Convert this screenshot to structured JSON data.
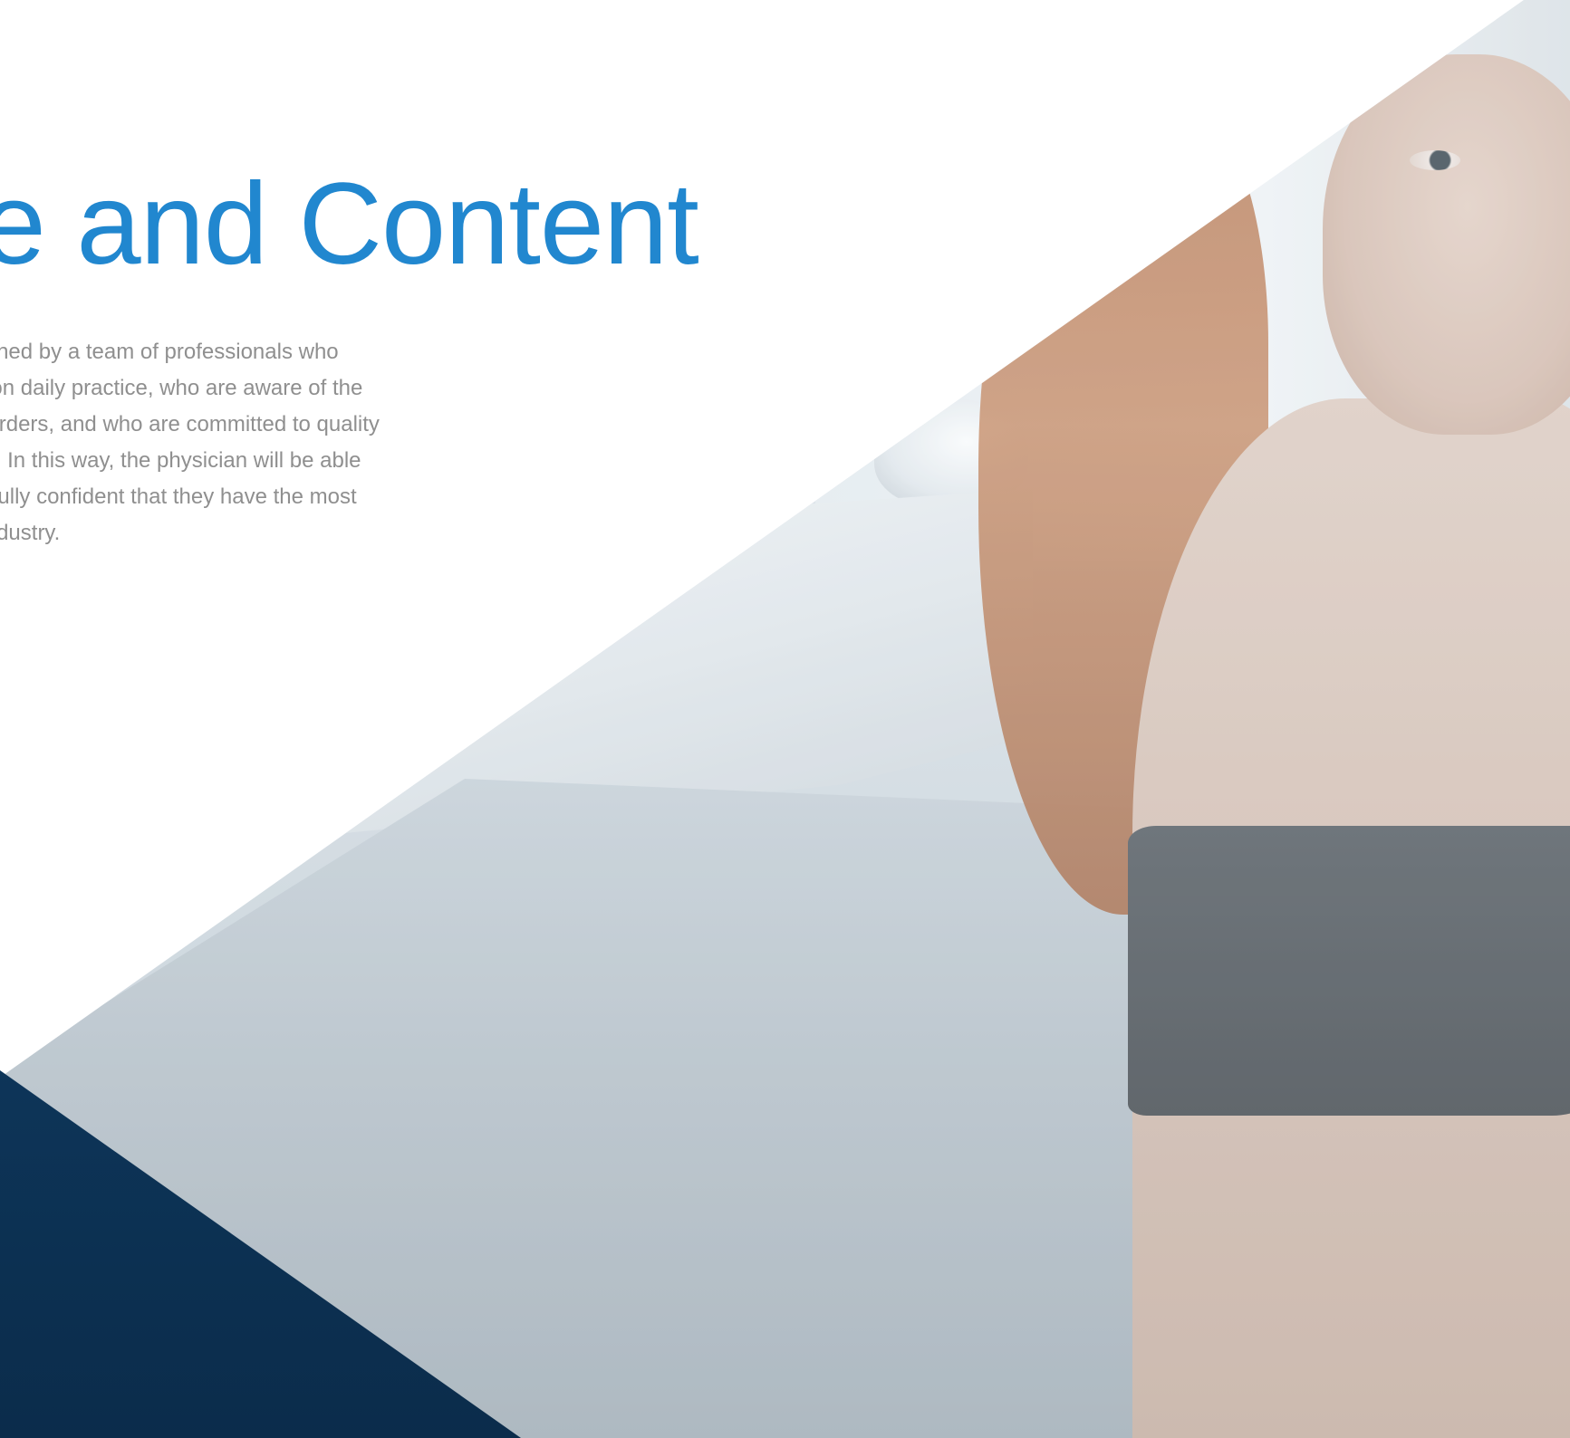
{
  "hero": {
    "headline": "re and Content",
    "paragraph_lines": [
      "een designed by a team of professionals who",
      "ning has on daily practice, who are aware of the",
      "ating Disorders, and who are committed to quality",
      "hnologies. In this way, the physician will be able",
      "rk, being fully confident that they have the most",
      "e in the industry."
    ]
  },
  "colors": {
    "headline": "#2187cf",
    "paragraph": "#8f8f8f",
    "navy_corner": "#103f68",
    "background": "#ffffff"
  }
}
